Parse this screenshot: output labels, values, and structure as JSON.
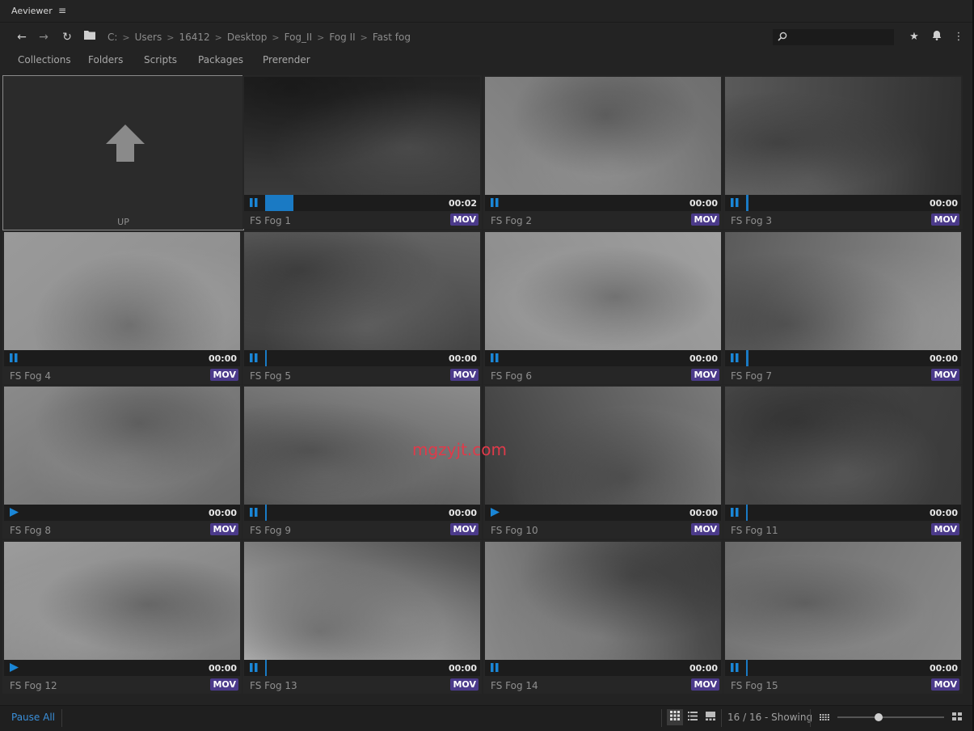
{
  "app": {
    "title": "Aeviewer",
    "menu_glyph": "≡"
  },
  "nav": {
    "back": "←",
    "forward": "→",
    "refresh": "↻",
    "folder": "▆",
    "breadcrumbs": [
      "C:",
      "Users",
      "16412",
      "Desktop",
      "Fog_II",
      "Fog II",
      "Fast fog"
    ],
    "separator": ">"
  },
  "search": {
    "placeholder": "",
    "value": ""
  },
  "tabs": [
    "Collections",
    "Folders",
    "Scripts",
    "Packages",
    "Prerender"
  ],
  "up_tile": {
    "label": "UP"
  },
  "items": [
    {
      "name": "FS Fog 1",
      "time": "00:02",
      "state": "pause",
      "progress": 0.12,
      "format": "MOV",
      "tone": [
        "#3a3a3a",
        "#222222"
      ]
    },
    {
      "name": "FS Fog 2",
      "time": "00:00",
      "state": "pause",
      "progress": 0.0,
      "format": "MOV",
      "tone": [
        "#8a8a8a",
        "#6e6e6e"
      ]
    },
    {
      "name": "FS Fog 3",
      "time": "00:00",
      "state": "pause",
      "progress": 0.01,
      "format": "MOV",
      "tone": [
        "#5a5a5a",
        "#2e2e2e"
      ]
    },
    {
      "name": "FS Fog 4",
      "time": "00:00",
      "state": "pause",
      "progress": 0.0,
      "format": "MOV",
      "tone": [
        "#9a9a9a",
        "#8c8c8c"
      ]
    },
    {
      "name": "FS Fog 5",
      "time": "00:00",
      "state": "pause",
      "progress": 0.005,
      "format": "MOV",
      "tone": [
        "#666666",
        "#3c3c3c"
      ]
    },
    {
      "name": "FS Fog 6",
      "time": "00:00",
      "state": "pause",
      "progress": 0.0,
      "format": "MOV",
      "tone": [
        "#a0a0a0",
        "#8a8a8a"
      ]
    },
    {
      "name": "FS Fog 7",
      "time": "00:00",
      "state": "pause",
      "progress": 0.01,
      "format": "MOV",
      "tone": [
        "#8e8e8e",
        "#5a5a5a"
      ]
    },
    {
      "name": "FS Fog 8",
      "time": "00:00",
      "state": "play",
      "progress": 0.0,
      "format": "MOV",
      "tone": [
        "#6a6a6a",
        "#8a8a8a"
      ]
    },
    {
      "name": "FS Fog 9",
      "time": "00:00",
      "state": "pause",
      "progress": 0.005,
      "format": "MOV",
      "tone": [
        "#4a4a4a",
        "#8c8c8c"
      ]
    },
    {
      "name": "FS Fog 10",
      "time": "00:00",
      "state": "play",
      "progress": 0.0,
      "format": "MOV",
      "tone": [
        "#3a3a3a",
        "#7a7a7a"
      ]
    },
    {
      "name": "FS Fog 11",
      "time": "00:00",
      "state": "pause",
      "progress": 0.005,
      "format": "MOV",
      "tone": [
        "#4a4a4a",
        "#3a3a3a"
      ]
    },
    {
      "name": "FS Fog 12",
      "time": "00:00",
      "state": "play",
      "progress": 0.0,
      "format": "MOV",
      "tone": [
        "#9c9c9c",
        "#7a7a7a"
      ]
    },
    {
      "name": "FS Fog 13",
      "time": "00:00",
      "state": "pause",
      "progress": 0.005,
      "format": "MOV",
      "tone": [
        "#4a4a4a",
        "#b8b8b8"
      ]
    },
    {
      "name": "FS Fog 14",
      "time": "00:00",
      "state": "pause",
      "progress": 0.0,
      "format": "MOV",
      "tone": [
        "#3e3e3e",
        "#8a8a8a"
      ]
    },
    {
      "name": "FS Fog 15",
      "time": "00:00",
      "state": "pause",
      "progress": 0.005,
      "format": "MOV",
      "tone": [
        "#8a8a8a",
        "#6a6a6a"
      ]
    }
  ],
  "watermark": "mgzyjt.com",
  "status": {
    "pause_all": "Pause All",
    "count": "16 / 16 - Showing",
    "size_slider": 0.38
  },
  "colors": {
    "accent": "#1a86d6",
    "badge": "#4b3a8a"
  },
  "icons": {
    "pause": "❚❚",
    "play": "▶",
    "star": "★",
    "bell": "🔔",
    "more": "⋮",
    "search": "⚲",
    "grid": "▦",
    "list": "☰",
    "filmstrip": "▬",
    "small-grid": "▦",
    "large-grid": "▦"
  }
}
